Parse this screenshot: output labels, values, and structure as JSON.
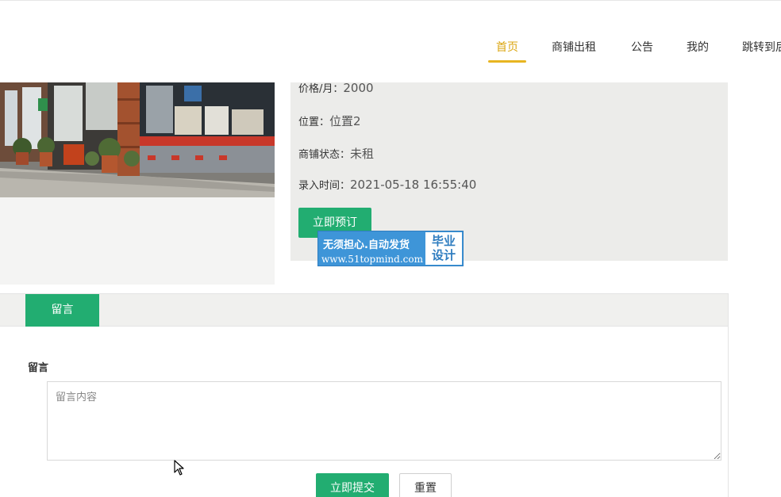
{
  "nav": {
    "items": [
      {
        "label": "首页",
        "active": true
      },
      {
        "label": "商铺出租",
        "active": false
      },
      {
        "label": "公告",
        "active": false
      },
      {
        "label": "我的",
        "active": false
      },
      {
        "label": "跳转到后台",
        "active": false
      }
    ]
  },
  "info": {
    "price_label": "价格/月：",
    "price_value": "2000",
    "location_label": "位置：",
    "location_value": "位置2",
    "status_label": "商铺状态：",
    "status_value": "未租",
    "time_label": "录入时间：",
    "time_value": "2021-05-18 16:55:40",
    "book_button": "立即预订"
  },
  "watermark": {
    "line1": "无须担心.自动发货",
    "line2": "www.51topmind.com",
    "right_top": "毕业",
    "right_bottom": "设计"
  },
  "tabs": {
    "active_label": "留言"
  },
  "form": {
    "label": "留言",
    "textarea_placeholder": "留言内容",
    "submit_button": "立即提交",
    "reset_button": "重置"
  },
  "colors": {
    "accent_green": "#22ad71",
    "nav_active": "#dba612",
    "watermark_blue": "#3e95d8"
  }
}
